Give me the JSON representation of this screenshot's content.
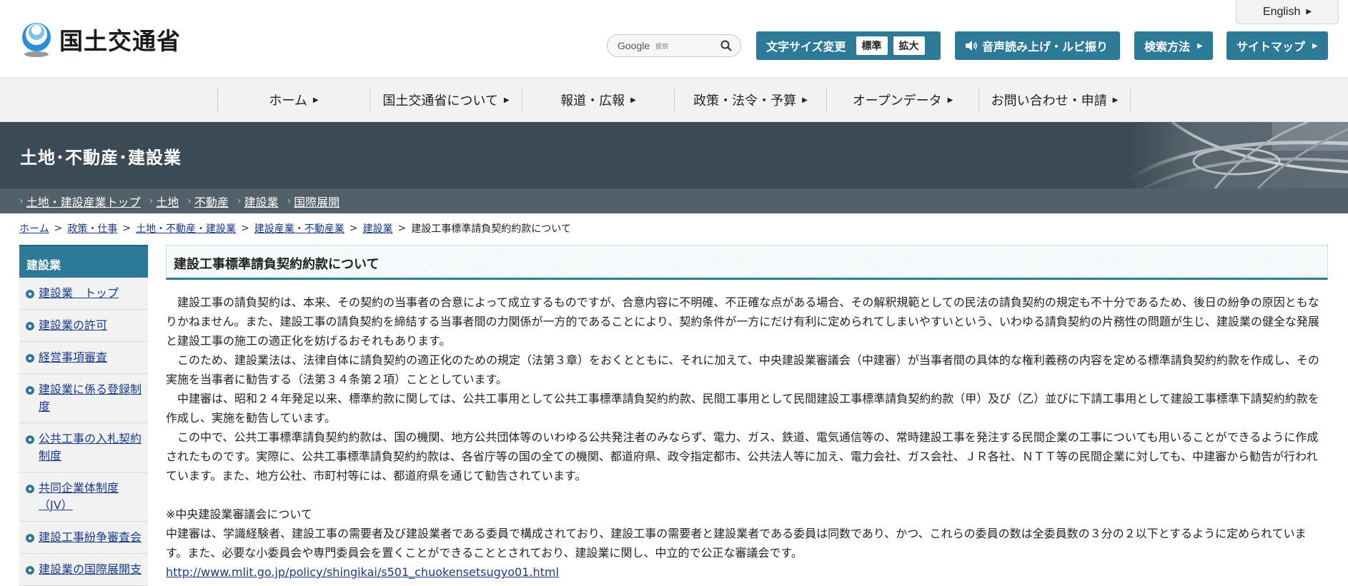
{
  "header": {
    "logo_text": "国土交通省",
    "english_label": "English",
    "search": {
      "brand": "Google",
      "provided": "提供",
      "placeholder": ""
    },
    "font_size_label": "文字サイズ変更",
    "font_size_options": [
      "標準",
      "拡大"
    ],
    "speech_label": "音声読み上げ・ルビ振り",
    "search_method_label": "検索方法",
    "sitemap_label": "サイトマップ"
  },
  "global_nav": [
    {
      "label": "ホーム"
    },
    {
      "label": "国土交通省について"
    },
    {
      "label": "報道・広報"
    },
    {
      "label": "政策・法令・予算"
    },
    {
      "label": "オープンデータ"
    },
    {
      "label": "お問い合わせ・申請"
    }
  ],
  "banner": {
    "title": "土地･不動産･建設業"
  },
  "sub_nav": [
    {
      "label": "土地・建設産業トップ"
    },
    {
      "label": "土地"
    },
    {
      "label": "不動産"
    },
    {
      "label": "建設業"
    },
    {
      "label": "国際展開"
    }
  ],
  "breadcrumb": [
    {
      "label": "ホーム"
    },
    {
      "label": "政策・仕事"
    },
    {
      "label": "土地・不動産・建設業"
    },
    {
      "label": "建設産業・不動産業"
    },
    {
      "label": "建設業"
    },
    {
      "label": "建設工事標準請負契約約款について"
    }
  ],
  "sidebar": {
    "heading": "建設業",
    "items": [
      {
        "label": "建設業　トップ"
      },
      {
        "label": "建設業の許可"
      },
      {
        "label": "経営事項審査"
      },
      {
        "label": "建設業に係る登録制度"
      },
      {
        "label": "公共工事の入札契約制度"
      },
      {
        "label": "共同企業体制度（JV）"
      },
      {
        "label": "建設工事紛争審査会"
      },
      {
        "label": "建設業の国際展開支"
      }
    ]
  },
  "main": {
    "title": "建設工事標準請負契約約款について",
    "paragraphs": [
      "建設工事の請負契約は、本来、その契約の当事者の合意によって成立するものですが、合意内容に不明確、不正確な点がある場合、その解釈規範としての民法の請負契約の規定も不十分であるため、後日の紛争の原因ともなりかねません。また、建設工事の請負契約を締結する当事者間の力関係が一方的であることにより、契約条件が一方にだけ有利に定められてしまいやすいという、いわゆる請負契約の片務性の問題が生じ、建設業の健全な発展と建設工事の施工の適正化を妨げるおそれもあります。",
      "このため、建設業法は、法律自体に請負契約の適正化のための規定（法第３章）をおくとともに、それに加えて、中央建設業審議会（中建審）が当事者間の具体的な権利義務の内容を定める標準請負契約約款を作成し、その実施を当事者に勧告する（法第３４条第２項）こととしています。",
      "中建審は、昭和２４年発足以来、標準約款に関しては、公共工事用として公共工事標準請負契約約款、民間工事用として民間建設工事標準請負契約約款（甲）及び（乙）並びに下請工事用として建設工事標準下請契約約款を作成し、実施を勧告しています。",
      "この中で、公共工事標準請負契約約款は、国の機関、地方公共団体等のいわゆる公共発注者のみならず、電力、ガス、鉄道、電気通信等の、常時建設工事を発注する民間企業の工事についても用いることができるように作成されたものです。実際に、公共工事標準請負契約約款は、各省庁等の国の全ての機関、都道府県、政令指定都市、公共法人等に加え、電力会社、ガス会社、ＪＲ各社、ＮＴＴ等の民間企業に対しても、中建審から勧告が行われています。また、地方公社、市町村等には、都道府県を通じて勧告されています。"
    ],
    "note_heading": "※中央建設業審議会について",
    "note_text": "中建審は、学識経験者、建設工事の需要者及び建設業者である委員で構成されており、建設工事の需要者と建設業者である委員は同数であり、かつ、これらの委員の数は全委員数の３分の２以下とするように定められています。また、必要な小委員会や専門委員会を置くことができることとされており、建設業に関し、中立的で公正な審議会です。",
    "link_url": "http://www.mlit.go.jp/policy/shingikai/s501_chuokensetsugyo01.html"
  },
  "colors": {
    "accent": "#2c7a98",
    "banner": "#3b4a54",
    "subnav": "#526169",
    "link": "#1a3a8a"
  }
}
